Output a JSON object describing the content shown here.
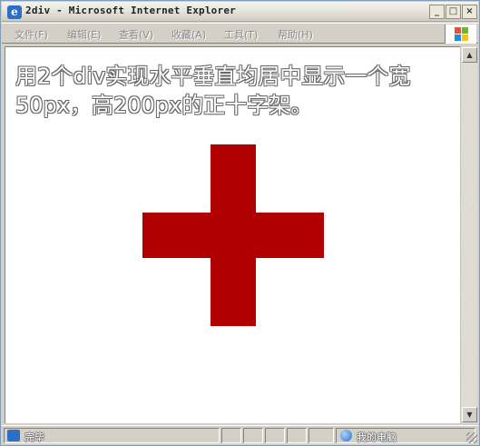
{
  "window": {
    "title": "2div - Microsoft Internet Explorer",
    "icon": "ie-icon",
    "controls": {
      "minimize": "_",
      "maximize": "□",
      "close": "×"
    }
  },
  "menubar": {
    "items": [
      {
        "label": "文件(F)"
      },
      {
        "label": "编辑(E)"
      },
      {
        "label": "查看(V)"
      },
      {
        "label": "收藏(A)"
      },
      {
        "label": "工具(T)"
      },
      {
        "label": "帮助(H)"
      }
    ]
  },
  "page": {
    "heading": "用2个div实现水平垂直均居中显示一个宽50px，高200px的正十字架。",
    "cross_color": "#b00000"
  },
  "scrollbar": {
    "up": "▲",
    "down": "▼"
  },
  "statusbar": {
    "status": "完毕",
    "zone": "我的电脑"
  }
}
